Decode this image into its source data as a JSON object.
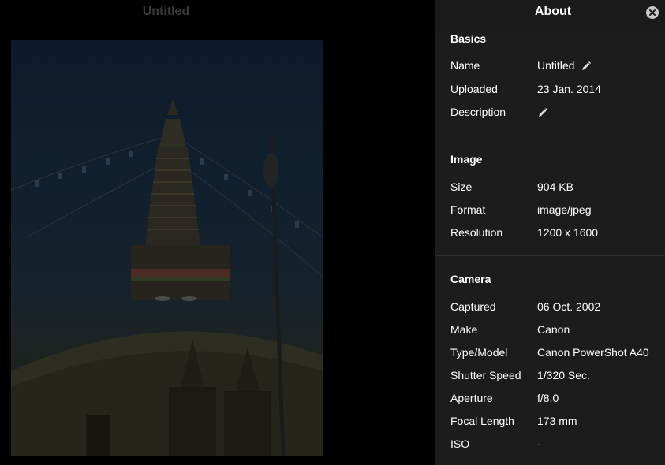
{
  "viewer": {
    "title": "Untitled"
  },
  "panel": {
    "title": "About",
    "close_icon": "close-icon",
    "sections": {
      "basics": {
        "title": "Basics",
        "name_label": "Name",
        "name_value": "Untitled",
        "uploaded_label": "Uploaded",
        "uploaded_value": "23 Jan. 2014",
        "description_label": "Description",
        "description_value": ""
      },
      "image": {
        "title": "Image",
        "size_label": "Size",
        "size_value": "904 KB",
        "format_label": "Format",
        "format_value": "image/jpeg",
        "resolution_label": "Resolution",
        "resolution_value": "1200 x 1600"
      },
      "camera": {
        "title": "Camera",
        "captured_label": "Captured",
        "captured_value": "06 Oct. 2002",
        "make_label": "Make",
        "make_value": "Canon",
        "model_label": "Type/Model",
        "model_value": "Canon PowerShot A40",
        "shutter_label": "Shutter Speed",
        "shutter_value": "1/320 Sec.",
        "aperture_label": "Aperture",
        "aperture_value": "f/8.0",
        "focal_label": "Focal Length",
        "focal_value": "173 mm",
        "iso_label": "ISO",
        "iso_value": "-"
      }
    }
  },
  "colors": {
    "panel_bg": "#1c1c1c",
    "viewer_bg": "#000000",
    "title_dim": "#3a3a3a"
  }
}
